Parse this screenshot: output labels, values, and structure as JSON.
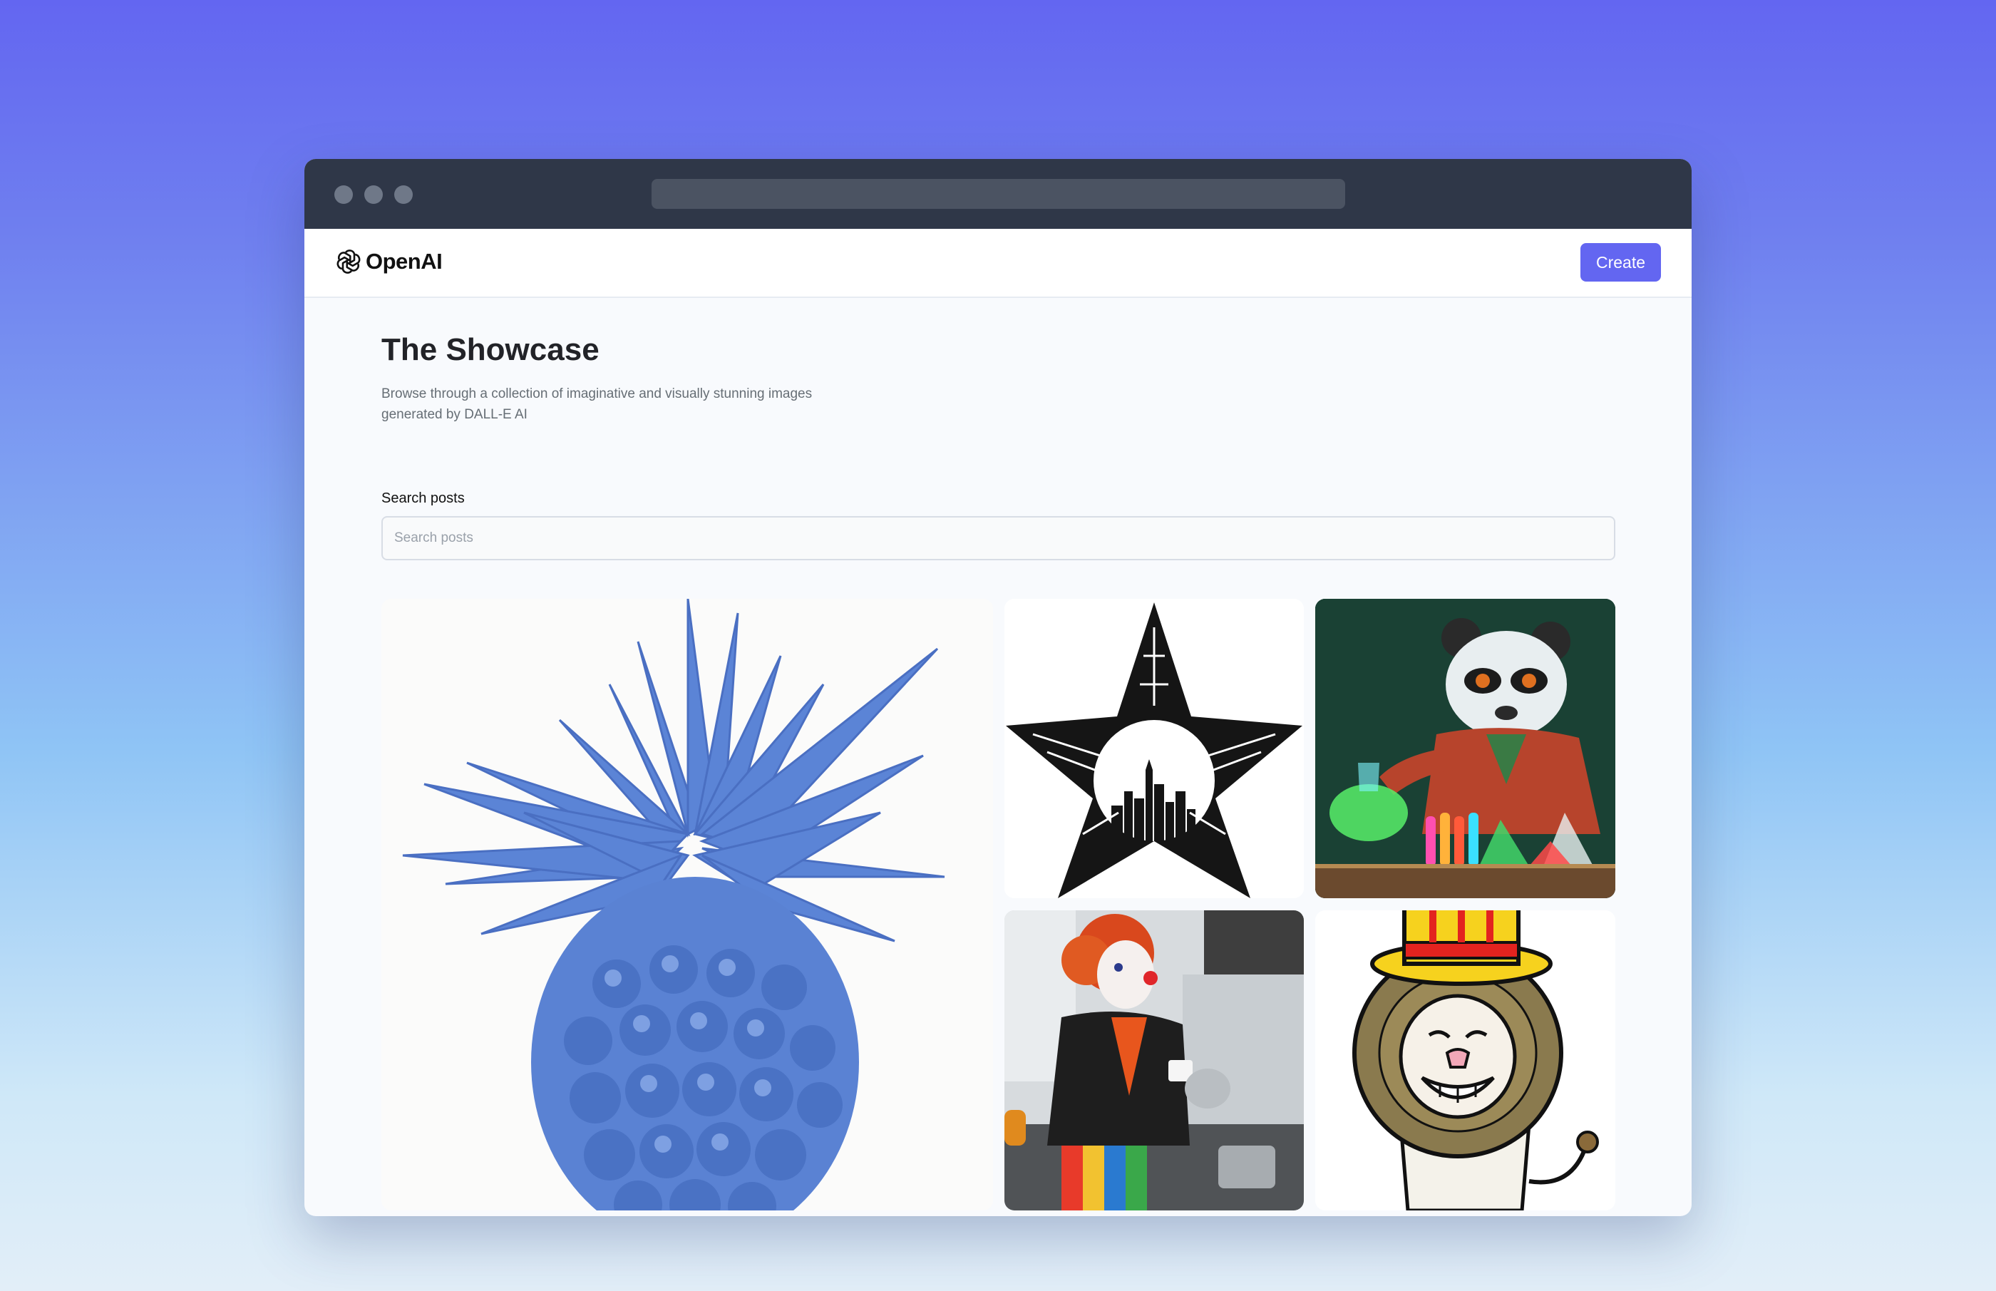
{
  "brand": {
    "name": "OpenAI",
    "logo_icon": "openai-logo-icon"
  },
  "header": {
    "create_label": "Create"
  },
  "page": {
    "title": "The Showcase",
    "subtitle": "Browse through a collection of imaginative and visually stunning images generated by DALL-E AI"
  },
  "search": {
    "label": "Search posts",
    "placeholder": "Search posts",
    "value": ""
  },
  "colors": {
    "accent": "#6366f1",
    "titlebar": "#2f3748",
    "title_text": "#222328",
    "subtitle_text": "#666e75"
  },
  "gallery": {
    "items": [
      {
        "name": "blue-pineapple-image"
      },
      {
        "name": "star-city-skyline-image"
      },
      {
        "name": "panda-scientist-image"
      },
      {
        "name": "clown-pouring-coffee-image"
      },
      {
        "name": "lion-top-hat-cartoon-image"
      }
    ]
  }
}
